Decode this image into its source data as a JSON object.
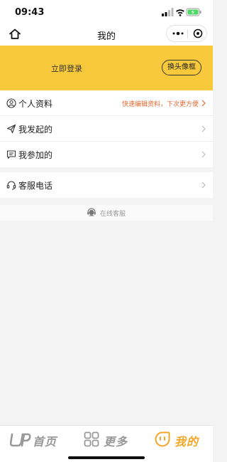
{
  "status_bar": {
    "time": "09:43"
  },
  "nav": {
    "title": "我的"
  },
  "login": {
    "text": "立即登录",
    "avatar_button": "换头像框"
  },
  "menu": {
    "profile": {
      "label": "个人资料",
      "hint": "快速编辑资料，下次更方便",
      "icon": "person-circle-icon"
    },
    "initiated": {
      "label": "我发起的",
      "icon": "paper-plane-icon"
    },
    "joined": {
      "label": "我参加的",
      "icon": "chat-bubble-icon"
    },
    "service_phone": {
      "label": "客服电话",
      "icon": "headset-icon"
    }
  },
  "online_service": {
    "label": "在线客服"
  },
  "tabs": [
    {
      "label": "首页",
      "icon": "home-logo-icon",
      "active": false
    },
    {
      "label": "更多",
      "icon": "grid-icon",
      "active": false
    },
    {
      "label": "我的",
      "icon": "smile-icon",
      "active": true
    }
  ],
  "colors": {
    "accent": "#f8c93a",
    "hint": "#e8662f",
    "tab_active": "#f5a524",
    "tab_inactive": "#999999"
  }
}
